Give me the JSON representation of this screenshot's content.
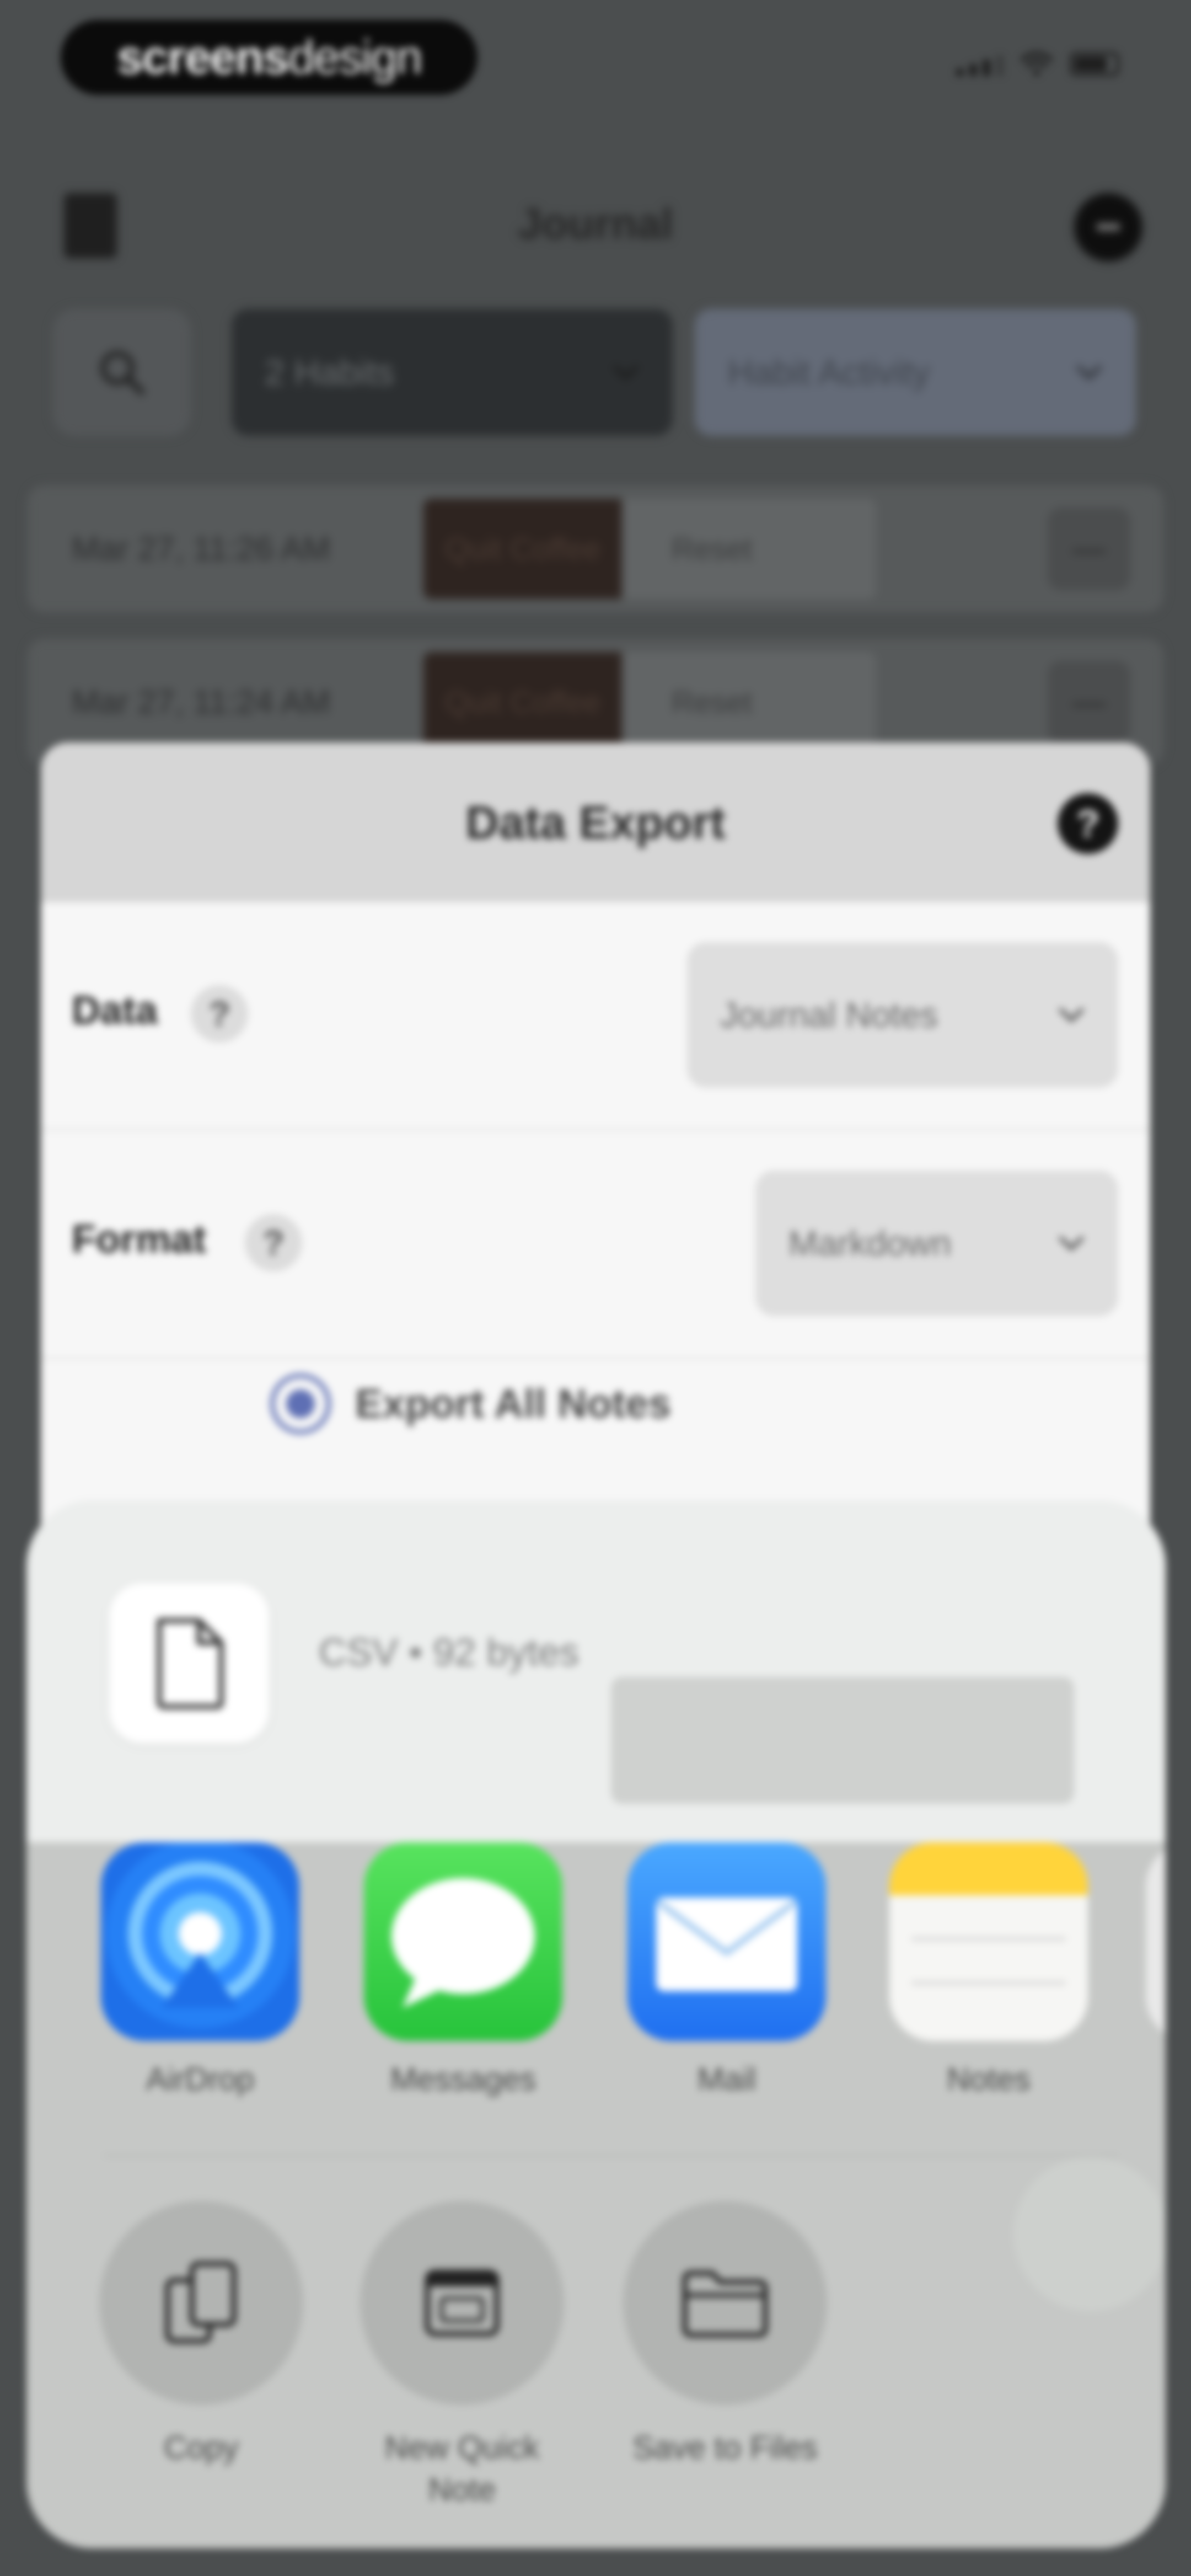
{
  "status_bar": {
    "logo_bold": "screens",
    "logo_light": "design"
  },
  "header": {
    "title": "Journal"
  },
  "filters": {
    "habits_select": "2 Habits",
    "activity_select": "Habit Activity"
  },
  "entries": [
    {
      "time": "Mar 27, 11:26 AM",
      "habit": "Quit Coffee",
      "action": "Reset"
    },
    {
      "time": "Mar 27, 11:24 AM",
      "habit": "Quit Coffee",
      "action": "Reset"
    }
  ],
  "export_modal": {
    "title": "Data Export",
    "help_glyph": "?",
    "data_label": "Data",
    "data_value": "Journal Notes",
    "format_label": "Format",
    "format_value": "Markdown",
    "radio_label": "Export All Notes"
  },
  "share_sheet": {
    "file_meta": "CSV • 92 bytes",
    "apps": [
      {
        "label": "AirDrop",
        "icon": "airdrop-icon"
      },
      {
        "label": "Messages",
        "icon": "messages-icon"
      },
      {
        "label": "Mail",
        "icon": "mail-icon"
      },
      {
        "label": "Notes",
        "icon": "notes-icon"
      }
    ],
    "actions": [
      {
        "label": "Copy",
        "icon": "copy-icon"
      },
      {
        "label": "New Quick Note",
        "icon": "quick-note-icon"
      },
      {
        "label": "Save to Files",
        "icon": "folder-icon"
      }
    ]
  }
}
